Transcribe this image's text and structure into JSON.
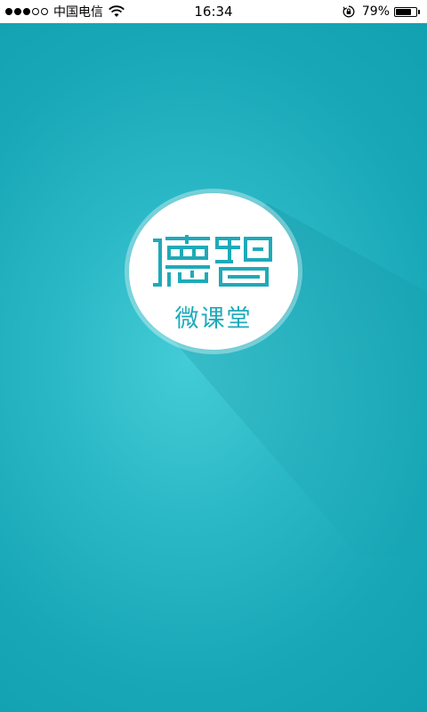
{
  "status_bar": {
    "carrier": "中国电信",
    "time": "16:34",
    "battery_percent": "79%",
    "battery_level": 0.79,
    "signal_bars_filled": 3,
    "signal_bars_total": 5,
    "icons": [
      "signal-dots-icon",
      "wifi-icon",
      "rotation-lock-icon",
      "battery-icon"
    ]
  },
  "splash": {
    "logo_text": "德智",
    "subtitle": "微课堂",
    "colors": {
      "background_center": "#43ccd6",
      "background_edge": "#11a0b0",
      "brand_teal": "#1eaab9",
      "circle": "#ffffff"
    }
  }
}
